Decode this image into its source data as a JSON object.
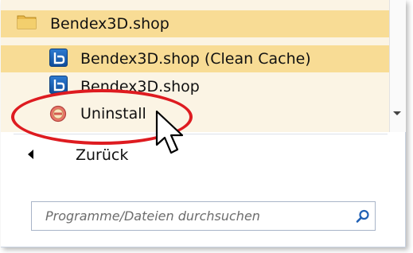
{
  "start_menu": {
    "programs": {
      "folder": {
        "label": "Bendex3D.shop",
        "icon": "folder-icon"
      },
      "items": [
        {
          "label": "Bendex3D.shop (Clean Cache)",
          "icon": "app-icon"
        },
        {
          "label": "Bendex3D.shop",
          "icon": "app-icon"
        },
        {
          "label": "Uninstall",
          "icon": "uninstall-icon"
        }
      ]
    },
    "back": {
      "label": "Zurück",
      "icon": "arrow-left-icon"
    },
    "search": {
      "placeholder": "Programme/Dateien durchsuchen",
      "value": "",
      "icon": "search-icon"
    }
  },
  "annotation": {
    "color": "#de1b20",
    "target": "Uninstall"
  },
  "colors": {
    "hover_highlight": "#f8dc95",
    "list_background": "#fbf4e4",
    "search_border": "#a8b4c8"
  }
}
